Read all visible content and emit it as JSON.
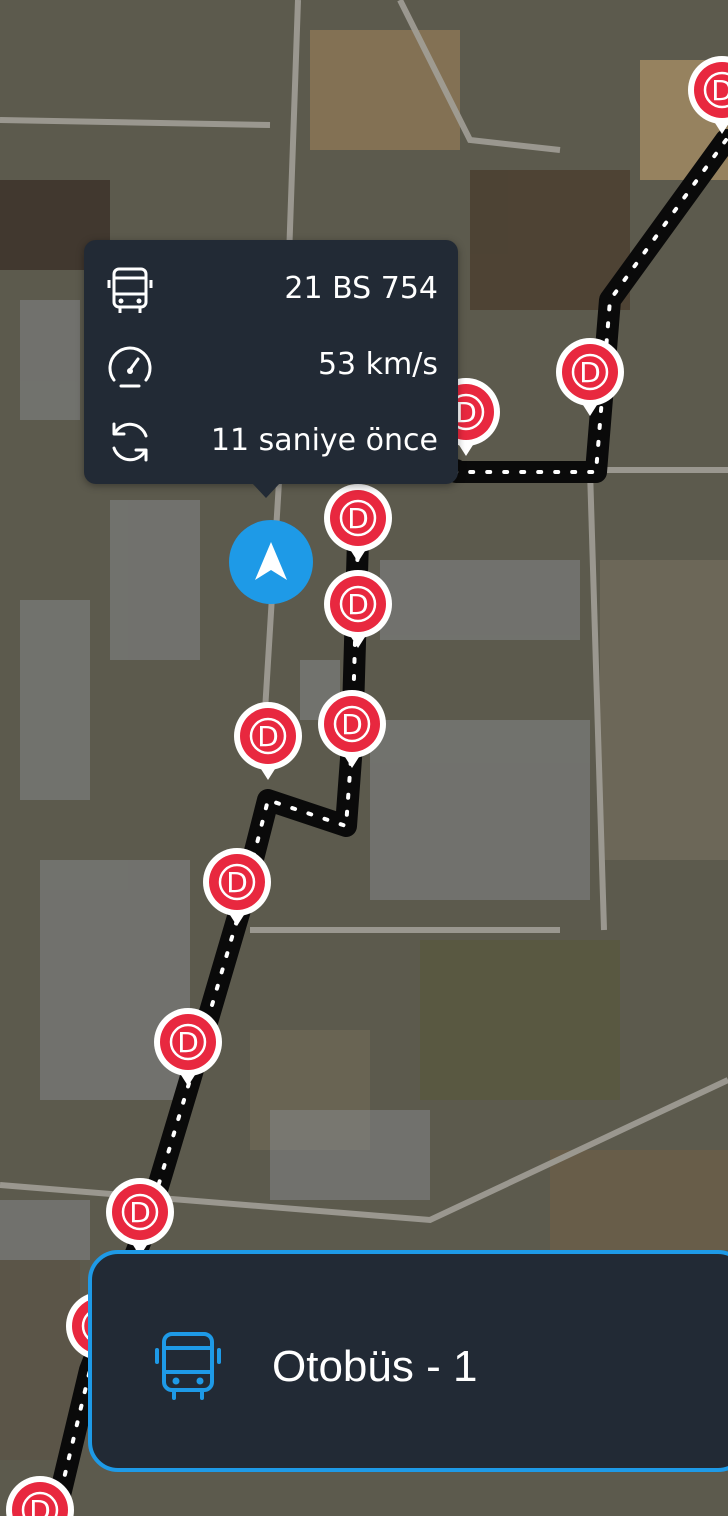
{
  "map": {
    "stop_marker_letter": "D",
    "stop_count": 14,
    "route_color": "#000000",
    "stop_color": "#e8283f"
  },
  "info_card": {
    "plate": "21 BS 754",
    "speed": "53 km/s",
    "last_update": "11 saniye önce",
    "icons": [
      "bus-icon",
      "speedometer-icon",
      "refresh-icon"
    ]
  },
  "vehicle_marker": {
    "icon": "navigation-arrow-icon",
    "color": "#1e9ae7"
  },
  "bottom_card": {
    "title": "Otobüs - 1",
    "icon": "bus-icon",
    "accent": "#1e9ae7"
  }
}
